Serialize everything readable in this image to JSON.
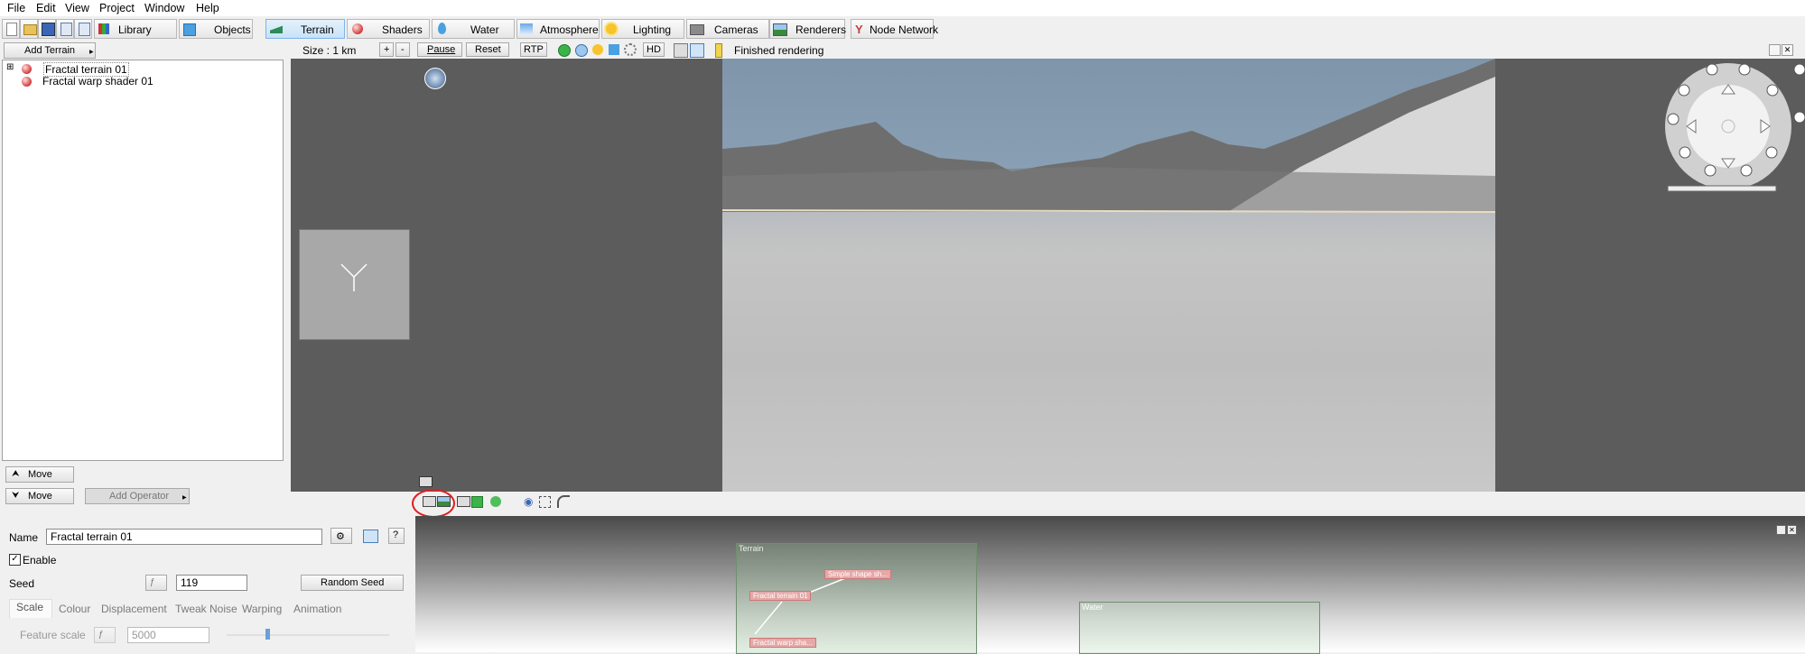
{
  "menu": [
    "File",
    "Edit",
    "View",
    "Project",
    "Window",
    "Help"
  ],
  "toolbar": {
    "tabs": [
      "Library",
      "Objects",
      "Terrain",
      "Shaders",
      "Water",
      "Atmosphere",
      "Lighting",
      "Cameras",
      "Renderers",
      "Node Network"
    ],
    "active_tab": "Terrain"
  },
  "left": {
    "add_terrain": "Add Terrain",
    "tree": [
      "Fractal terrain 01",
      "Fractal warp shader 01"
    ],
    "move_up": "Move",
    "move_down": "Move",
    "add_operator": "Add Operator"
  },
  "viewport": {
    "size_label": "Size : 1 km",
    "zoom_in": "+",
    "zoom_out": "-",
    "pause": "Pause",
    "reset": "Reset",
    "rtp": "RTP",
    "hd": "HD",
    "status": "Finished rendering"
  },
  "props": {
    "name_label": "Name",
    "name_value": "Fractal terrain 01",
    "help": "?",
    "enable_label": "Enable",
    "seed_label": "Seed",
    "seed_value": "119",
    "random_seed": "Random Seed",
    "tabs": [
      "Scale",
      "Colour",
      "Displacement",
      "Tweak Noise",
      "Warping",
      "Animation"
    ],
    "feature_scale_label": "Feature scale",
    "feature_scale_value": "5000"
  },
  "nodes": {
    "terrain_group": "Terrain",
    "water_group": "Water",
    "node_shape": "Simple shape sh...",
    "node_fractal": "Fractal terrain 01",
    "node_warp": "Fractal warp sha..."
  },
  "colors": {
    "active_tab_bg": "#c8e2f7",
    "viewport_bg": "#5c5c5c",
    "highlight_circle": "#e02020"
  }
}
